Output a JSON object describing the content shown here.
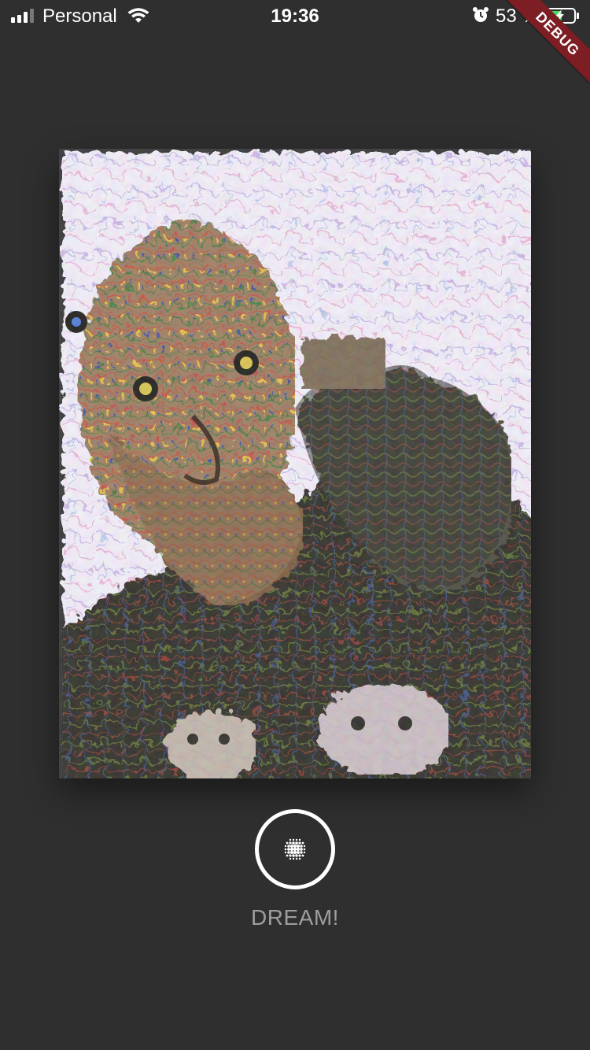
{
  "status_bar": {
    "carrier": "Personal",
    "time": "19:36",
    "battery_percent": "53 %",
    "signal_icon": "signal-bars-icon",
    "wifi_icon": "wifi-icon",
    "alarm_icon": "alarm-clock-icon",
    "battery_icon": "battery-charging-icon"
  },
  "debug_banner": {
    "label": "DEBUG",
    "color": "#7d1e24"
  },
  "main": {
    "photo_description_icon": "dream-image",
    "dream_button": {
      "icon": "dots-grid-icon",
      "label": "DREAM!"
    }
  },
  "colors": {
    "background": "#2f2f2f",
    "label": "#9e9e9e",
    "button_ring": "#ffffff"
  }
}
